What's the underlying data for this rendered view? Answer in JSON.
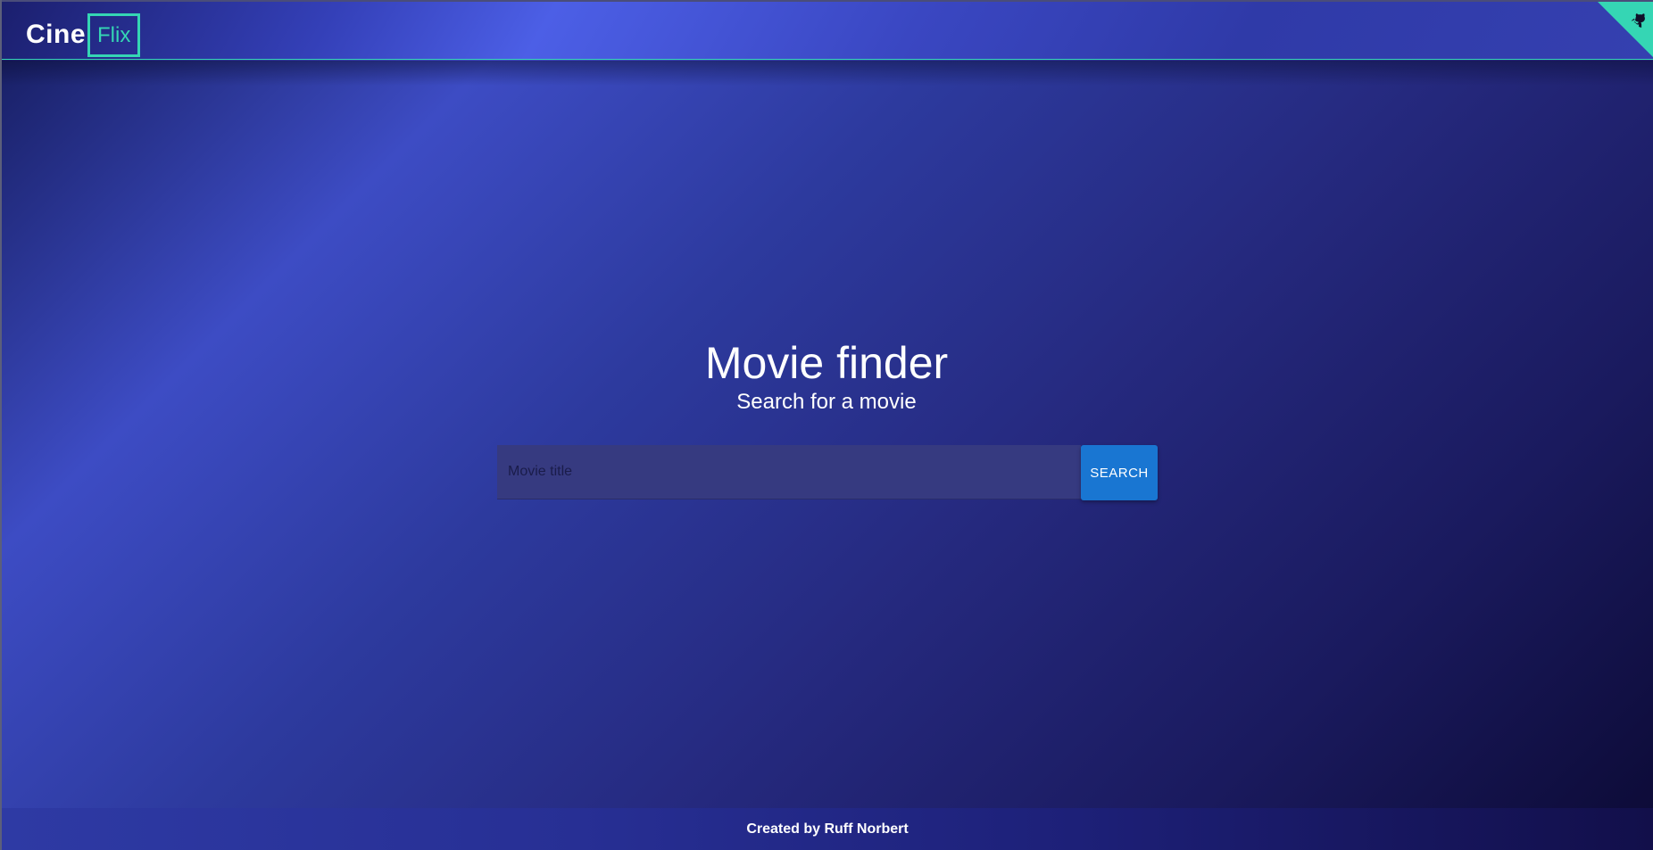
{
  "header": {
    "logo_primary": "Cine",
    "logo_secondary": "Flix",
    "corner_icon": "github-octocat-icon"
  },
  "hero": {
    "title": "Movie finder",
    "subtitle": "Search for a movie"
  },
  "search": {
    "placeholder": "Movie title",
    "value": "",
    "button_label": "SEARCH"
  },
  "footer": {
    "credit": "Created by Ruff Norbert"
  },
  "colors": {
    "accent": "#35d6b4",
    "button": "#1976d2",
    "background_dark": "#0c0a35",
    "background_light": "#4c5fe6"
  }
}
